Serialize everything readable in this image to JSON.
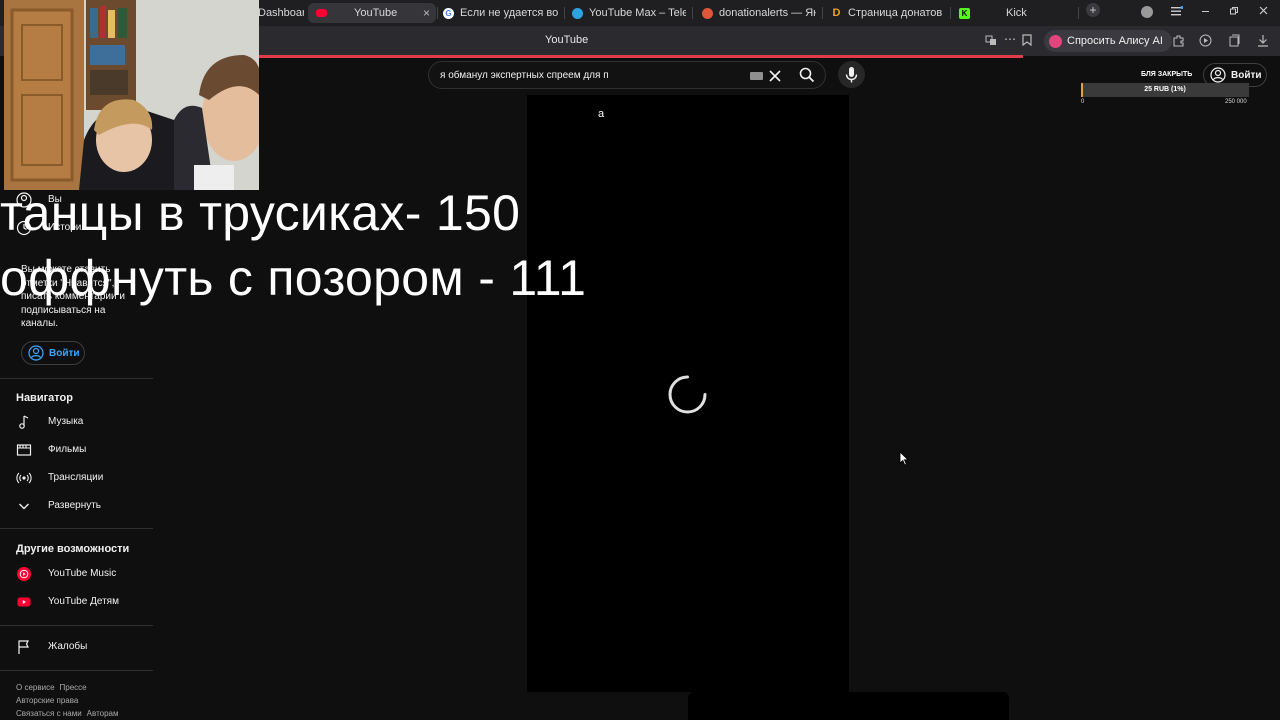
{
  "browser": {
    "tabs": [
      {
        "title": "Dashboard",
        "favicon": "dashboard-tab-icon"
      },
      {
        "title": "YouTube",
        "favicon": "youtube-tab-icon",
        "active": true
      },
      {
        "title": "Если не удается войти в",
        "favicon": "google-tab-icon"
      },
      {
        "title": "YouTube Max – Telegram",
        "favicon": "telegram-tab-icon"
      },
      {
        "title": "donationalerts — Яндекс",
        "favicon": "donationalerts-tab-icon"
      },
      {
        "title": "Страница донатов - Don",
        "favicon": "donatepay-tab-icon"
      },
      {
        "title": "Kick",
        "favicon": "kick-tab-icon"
      }
    ],
    "close_glyph": "×",
    "new_tab_glyph": "+",
    "page_title": "YouTube",
    "alice_label": "Спросить Алису AI"
  },
  "youtube": {
    "search_value": "я обманул экспертных спреем для п",
    "signin_label": "Войти",
    "player_letter": "а"
  },
  "donation_widget": {
    "title": "БЛЯ ЗАКРЫТЬ",
    "amount": "25 RUB (1%)",
    "min": "0",
    "max": "250 000",
    "progress_percent": 1
  },
  "overlay": {
    "line1": "танцы в трусиках- 150",
    "line2": "оффнуть с позором - 111"
  },
  "sidebar": {
    "you": "Вы",
    "history": "История",
    "promo_text": "Вы можете ставить отметки \"Нравится\", писать комментарии и подписываться на каналы.",
    "signin_label": "Войти",
    "navigator_title": "Навигатор",
    "nav_items": [
      {
        "label": "Музыка",
        "icon": "music-note-icon"
      },
      {
        "label": "Фильмы",
        "icon": "film-icon"
      },
      {
        "label": "Трансляции",
        "icon": "live-broadcast-icon"
      },
      {
        "label": "Развернуть",
        "icon": "chevron-down-icon"
      }
    ],
    "more_title": "Другие возможности",
    "more_items": [
      {
        "label": "YouTube Music",
        "icon": "youtube-music-icon"
      },
      {
        "label": "YouTube Детям",
        "icon": "youtube-kids-icon"
      }
    ],
    "report_label": "Жалобы",
    "footer": [
      [
        "О сервисе",
        "Прессе"
      ],
      [
        "Авторские права"
      ],
      [
        "Связаться с нами",
        "Авторам"
      ]
    ]
  },
  "colors": {
    "background": "#0f0f0f",
    "accent_red": "#e23c4a",
    "link_blue": "#3ea6ff",
    "youtube_red": "#ff0033"
  }
}
